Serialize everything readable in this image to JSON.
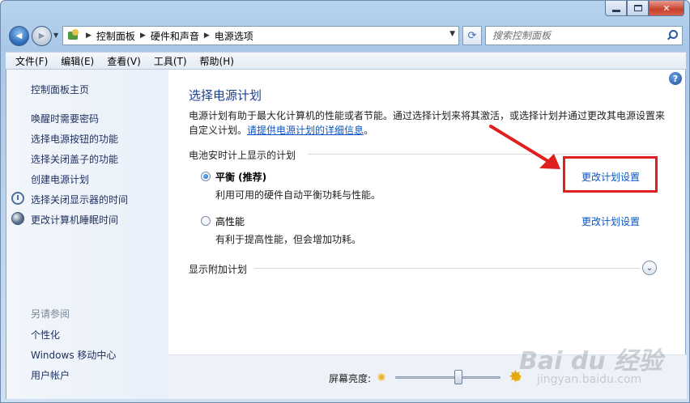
{
  "window": {
    "caption_buttons": {
      "minimize": "",
      "maximize": "",
      "close": "✕"
    }
  },
  "nav": {
    "back_glyph": "◀",
    "forward_glyph": "▶",
    "breadcrumbs": [
      "控制面板",
      "硬件和声音",
      "电源选项"
    ],
    "separator": "▶",
    "refresh_glyph": "⟳",
    "search_placeholder": "搜索控制面板"
  },
  "menu": [
    "文件(F)",
    "编辑(E)",
    "查看(V)",
    "工具(T)",
    "帮助(H)"
  ],
  "sidebar": {
    "home": "控制面板主页",
    "links": [
      "唤醒时需要密码",
      "选择电源按钮的功能",
      "选择关闭盖子的功能",
      "创建电源计划",
      "选择关闭显示器的时间",
      "更改计算机睡眠时间"
    ],
    "see_also_label": "另请参阅",
    "see_also": [
      "个性化",
      "Windows 移动中心",
      "用户帐户"
    ]
  },
  "main": {
    "help_glyph": "?",
    "title": "选择电源计划",
    "description": "电源计划有助于最大化计算机的性能或者节能。通过选择计划来将其激活，或选择计划并通过更改其电源设置来自定义计划。",
    "description_link": "请提供电源计划的详细信息",
    "description_end": "。",
    "section_heading": "电池安时计上显示的计划",
    "plans": [
      {
        "name": "平衡 (推荐)",
        "description": "利用可用的硬件自动平衡功耗与性能。",
        "link": "更改计划设置",
        "selected": true
      },
      {
        "name": "高性能",
        "description": "有利于提高性能，但会增加功耗。",
        "link": "更改计划设置",
        "selected": false
      }
    ],
    "more_plans": "显示附加计划",
    "expand_glyph": "⌄"
  },
  "footer": {
    "brightness_label": "屏幕亮度:",
    "brightness_level": 0.6
  },
  "watermark": {
    "main": "Bai du 经验",
    "sub": "jingyan.baidu.com"
  },
  "annotation_color": "#e0201f"
}
